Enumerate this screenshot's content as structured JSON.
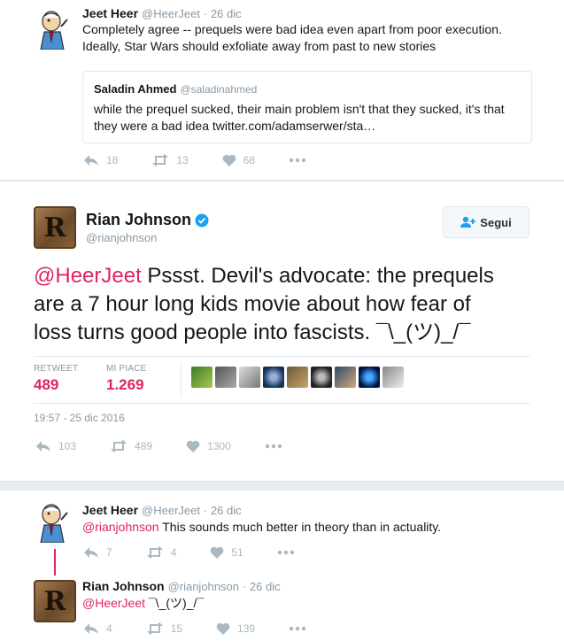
{
  "tweet1": {
    "name": "Jeet Heer",
    "handle": "@HeerJeet",
    "date": "· 26 dic",
    "text_line1": "Completely agree -- prequels were bad idea even apart from poor execution.",
    "text_line2": "Ideally, Star Wars should exfoliate away from past to new stories",
    "quote": {
      "name": "Saladin Ahmed",
      "handle": "@saladinahmed",
      "text_line1": "while the prequel sucked, their main problem isn't that they sucked, it's that",
      "text_line2": "they were a bad idea twitter.com/adamserwer/sta…"
    },
    "replies": "18",
    "retweets": "13",
    "likes": "68"
  },
  "main_tweet": {
    "name": "Rian Johnson",
    "handle": "@rianjohnson",
    "follow_label": "Segui",
    "mention": "@HeerJeet",
    "text_line1_rest": " Pssst. Devil's advocate: the prequels",
    "text_line2": "are a 7 hour long kids movie about how fear of",
    "text_line3": "loss turns good people into fascists. ¯\\_(ツ)_/¯",
    "retweet_label": "RETWEET",
    "retweet_count": "489",
    "likes_label": "MI PIACE",
    "likes_count": "1.269",
    "timestamp": "19:57 - 25 dic 2016",
    "replies": "103",
    "retweets": "489",
    "likes": "1300"
  },
  "reply1": {
    "name": "Jeet Heer",
    "handle": "@HeerJeet",
    "date": "· 26 dic",
    "mention": "@rianjohnson",
    "text": " This sounds much better in theory than in actuality.",
    "replies": "7",
    "retweets": "4",
    "likes": "51"
  },
  "reply2": {
    "name": "Rian Johnson",
    "handle": "@rianjohnson",
    "date": "· 26 dic",
    "mention": "@HeerJeet",
    "text": " ¯\\_(ツ)_/¯",
    "replies": "4",
    "retweets": "15",
    "likes": "139"
  },
  "avatar_letter": "R",
  "colors": {
    "accent": "#e0245e",
    "muted": "#8899a6",
    "icon": "#aab8c2",
    "verified": "#1da1f2"
  }
}
